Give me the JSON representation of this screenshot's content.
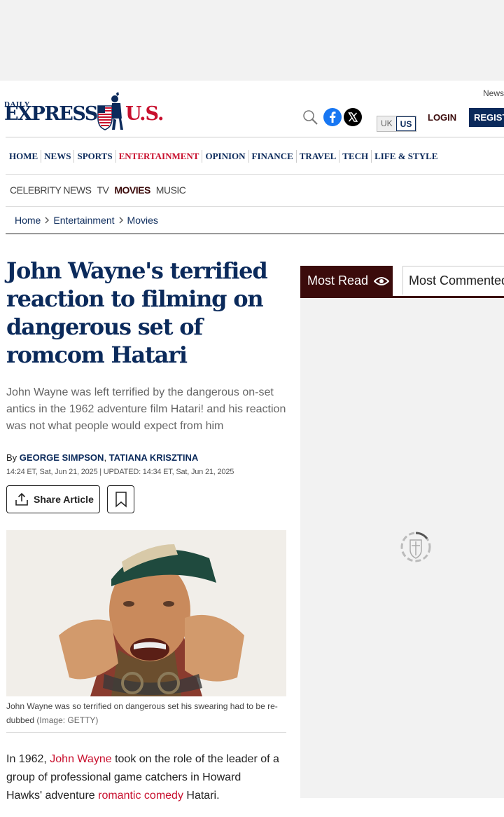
{
  "header": {
    "logo_daily": "DAILY",
    "logo_express": "EXPRESS",
    "logo_us": "U.S.",
    "newsletter": "News",
    "edition_uk": "UK",
    "edition_us": "US",
    "login": "LOGIN",
    "register": "REGIST"
  },
  "main_nav": {
    "items": [
      "HOME",
      "NEWS",
      "SPORTS",
      "ENTERTAINMENT",
      "OPINION",
      "FINANCE",
      "TRAVEL",
      "TECH",
      "LIFE & STYLE"
    ],
    "active": "ENTERTAINMENT"
  },
  "sub_nav": {
    "items": [
      "CELEBRITY NEWS",
      "TV",
      "MOVIES",
      "MUSIC"
    ],
    "active": "MOVIES"
  },
  "breadcrumb": [
    "Home",
    "Entertainment",
    "Movies"
  ],
  "article": {
    "headline": "John Wayne's terrified reaction to filming on dangerous set of romcom Hatari",
    "standfirst": "John Wayne was left terrified by the dangerous on-set antics in the 1962 adventure film Hatari! and his reaction was not what people would expect from him",
    "byline_prefix": "By ",
    "author_1": "GEORGE SIMPSON",
    "author_sep": ", ",
    "author_2": "TATIANA KRISZTINA",
    "dateline": "14:24 ET, Sat, Jun 21, 2025 | UPDATED: 14:34 ET, Sat, Jun 21, 2025",
    "share_label": "Share Article",
    "caption": "John Wayne was so terrified on dangerous set his swearing had to be re-dubbed",
    "caption_credit": "(Image: GETTY)",
    "body_1": "In 1962, ",
    "body_link_1": "John Wayne",
    "body_2": " took on the role of the leader of a group of professional game catchers in Howard Hawks' adventure ",
    "body_link_2": "romantic comedy",
    "body_3": " Hatari."
  },
  "sidebar": {
    "tab_most_read": "Most Read",
    "tab_most_commented": "Most Commented"
  },
  "colors": {
    "navy": "#0b2a5b",
    "red": "#c8102e",
    "maroon": "#3b0b0b"
  }
}
